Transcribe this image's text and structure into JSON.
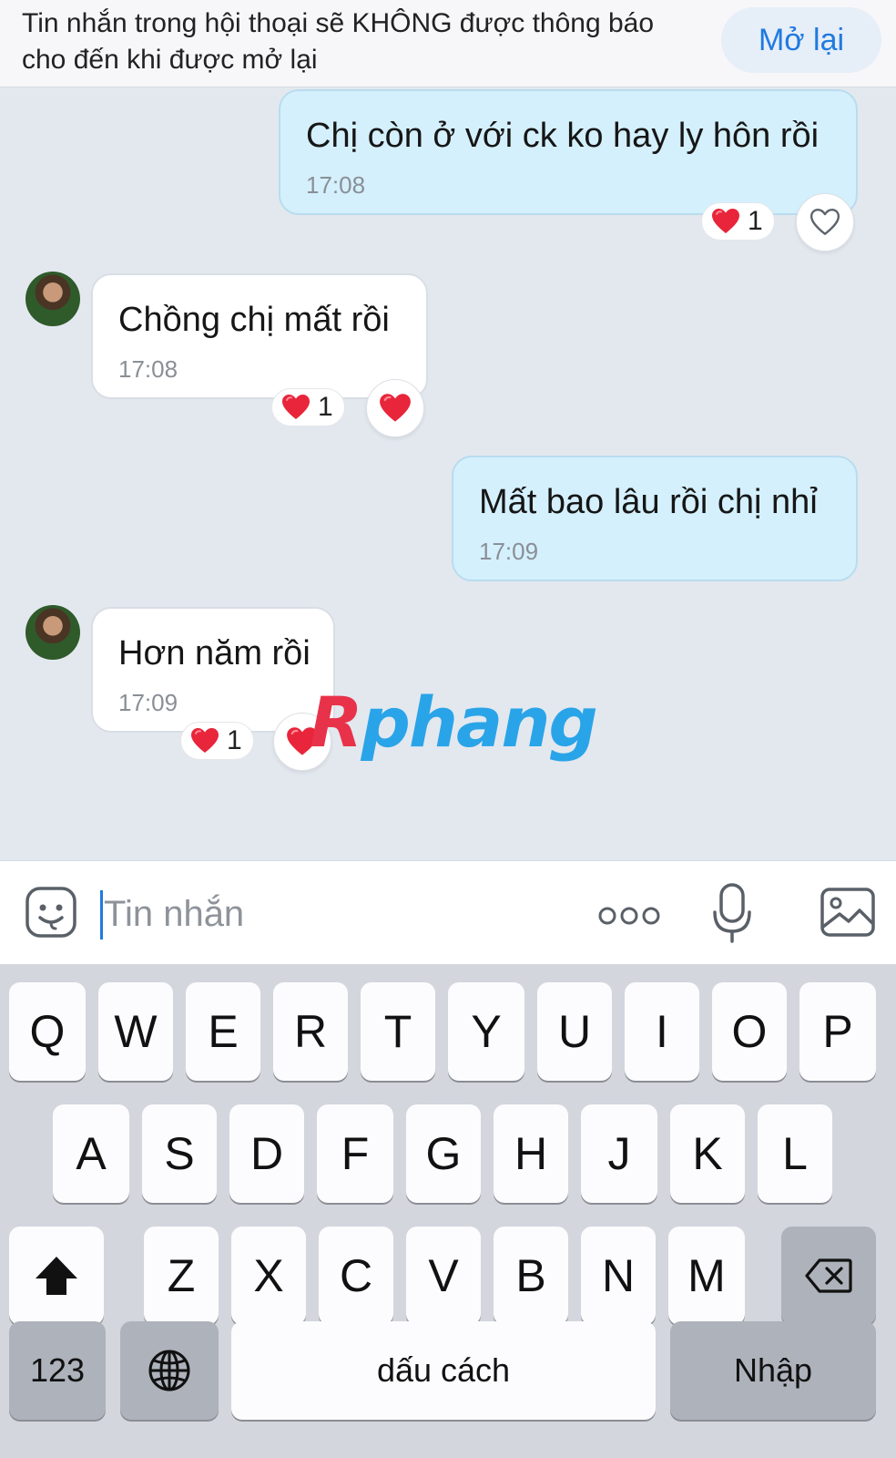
{
  "banner": {
    "text": "Tin nhắn trong hội thoại sẽ KHÔNG được thông báo cho đến khi được mở lại",
    "reopen_label": "Mở lại"
  },
  "messages": [
    {
      "direction": "outgoing",
      "text": "Chị còn ở với ck ko hay ly hôn rồi",
      "time": "17:08",
      "reaction_count": "1",
      "my_reaction": "heart-outline-icon"
    },
    {
      "direction": "incoming",
      "text": "Chồng chị mất rồi",
      "time": "17:08",
      "reaction_count": "1",
      "my_reaction": "heart-filled-icon"
    },
    {
      "direction": "outgoing",
      "text": "Mất bao lâu rồi chị nhỉ",
      "time": "17:09"
    },
    {
      "direction": "incoming",
      "text": "Hơn năm rồi",
      "time": "17:09",
      "reaction_count": "1",
      "my_reaction": "heart-filled-icon"
    }
  ],
  "watermark": "Rphang",
  "composer": {
    "placeholder": "Tin nhắn",
    "icons": [
      "emoji-icon",
      "more-icon",
      "microphone-icon",
      "image-icon"
    ]
  },
  "keyboard": {
    "row1": [
      "Q",
      "W",
      "E",
      "R",
      "T",
      "Y",
      "U",
      "I",
      "O",
      "P"
    ],
    "row2": [
      "A",
      "S",
      "D",
      "F",
      "G",
      "H",
      "J",
      "K",
      "L"
    ],
    "row3": [
      "Z",
      "X",
      "C",
      "V",
      "B",
      "N",
      "M"
    ],
    "numbers_label": "123",
    "space_label": "dấu cách",
    "return_label": "Nhập"
  },
  "colors": {
    "chat_background": "#e3e8ef",
    "outgoing_bubble": "#d4f0fd",
    "incoming_bubble": "#ffffff",
    "accent": "#1f7ae0",
    "heart": "#e8253a"
  }
}
